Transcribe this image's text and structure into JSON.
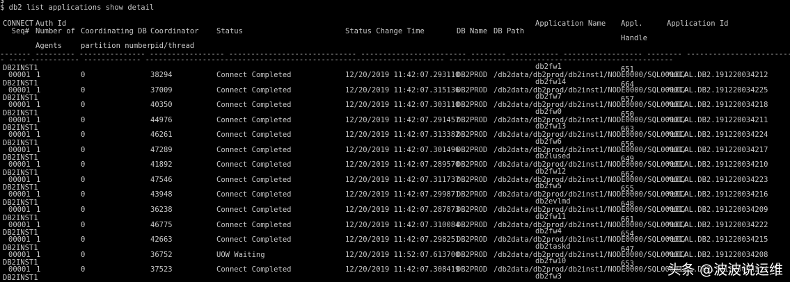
{
  "prompt_line": "$ db2 list applications show detail",
  "headers": {
    "connect_seq_1": "CONNECT",
    "connect_seq_2": "  Seq#",
    "auth_id": "Auth Id",
    "num_agents_1": "Number of",
    "num_agents_2": "Agents",
    "coord_db_part_1": "Coordinating DB",
    "coord_db_part_2": "partition number",
    "coord_pid_1": "Coordinator",
    "coord_pid_2": "pid/thread",
    "status": "Status",
    "status_change_time": "Status Change Time",
    "db_name": "DB Name",
    "db_path": "DB Path",
    "app_name": "Application Name",
    "appl_handle_1": "Appl.",
    "appl_handle_2": "Handle",
    "app_id": "Application Id"
  },
  "rows": [
    {
      "auth": "DB2INST1",
      "seq": "00001",
      "agents": "1",
      "part": "0",
      "pid": "38294",
      "status": "Connect Completed",
      "time": "12/20/2019 11:42:07.293110",
      "db": "DB2PROD",
      "path": "/db2data/db2prod/db2inst1/NODE0000/SQL00001/",
      "app": "db2fw1",
      "handle": "651",
      "appid": "*LOCAL.DB2.191220034212"
    },
    {
      "auth": "DB2INST1",
      "seq": "00001",
      "agents": "1",
      "part": "0",
      "pid": "37009",
      "status": "Connect Completed",
      "time": "12/20/2019 11:42:07.315136",
      "db": "DB2PROD",
      "path": "/db2data/db2prod/db2inst1/NODE0000/SQL00001/",
      "app": "db2fw14",
      "handle": "664",
      "appid": "*LOCAL.DB2.191220034225"
    },
    {
      "auth": "DB2INST1",
      "seq": "00001",
      "agents": "1",
      "part": "0",
      "pid": "40350",
      "status": "Connect Completed",
      "time": "12/20/2019 11:42:07.303110",
      "db": "DB2PROD",
      "path": "/db2data/db2prod/db2inst1/NODE0000/SQL00001/",
      "app": "db2fw7",
      "handle": "657",
      "appid": "*LOCAL.DB2.191220034218"
    },
    {
      "auth": "DB2INST1",
      "seq": "00001",
      "agents": "1",
      "part": "0",
      "pid": "44976",
      "status": "Connect Completed",
      "time": "12/20/2019 11:42:07.291457",
      "db": "DB2PROD",
      "path": "/db2data/db2prod/db2inst1/NODE0000/SQL00001/",
      "app": "db2fw0",
      "handle": "650",
      "appid": "*LOCAL.DB2.191220034211"
    },
    {
      "auth": "DB2INST1",
      "seq": "00001",
      "agents": "1",
      "part": "0",
      "pid": "46261",
      "status": "Connect Completed",
      "time": "12/20/2019 11:42:07.313382",
      "db": "DB2PROD",
      "path": "/db2data/db2prod/db2inst1/NODE0000/SQL00001/",
      "app": "db2fw13",
      "handle": "663",
      "appid": "*LOCAL.DB2.191220034224"
    },
    {
      "auth": "DB2INST1",
      "seq": "00001",
      "agents": "1",
      "part": "0",
      "pid": "47289",
      "status": "Connect Completed",
      "time": "12/20/2019 11:42:07.301496",
      "db": "DB2PROD",
      "path": "/db2data/db2prod/db2inst1/NODE0000/SQL00001/",
      "app": "db2fw6",
      "handle": "656",
      "appid": "*LOCAL.DB2.191220034217"
    },
    {
      "auth": "DB2INST1",
      "seq": "00001",
      "agents": "1",
      "part": "0",
      "pid": "41892",
      "status": "Connect Completed",
      "time": "12/20/2019 11:42:07.289570",
      "db": "DB2PROD",
      "path": "/db2data/db2prod/db2inst1/NODE0000/SQL00001/",
      "app": "db2lused",
      "handle": "649",
      "appid": "*LOCAL.DB2.191220034210"
    },
    {
      "auth": "DB2INST1",
      "seq": "00001",
      "agents": "1",
      "part": "0",
      "pid": "47546",
      "status": "Connect Completed",
      "time": "12/20/2019 11:42:07.311737",
      "db": "DB2PROD",
      "path": "/db2data/db2prod/db2inst1/NODE0000/SQL00001/",
      "app": "db2fw12",
      "handle": "662",
      "appid": "*LOCAL.DB2.191220034223"
    },
    {
      "auth": "DB2INST1",
      "seq": "00001",
      "agents": "1",
      "part": "0",
      "pid": "43948",
      "status": "Connect Completed",
      "time": "12/20/2019 11:42:07.299871",
      "db": "DB2PROD",
      "path": "/db2data/db2prod/db2inst1/NODE0000/SQL00001/",
      "app": "db2fw5",
      "handle": "655",
      "appid": "*LOCAL.DB2.191220034216"
    },
    {
      "auth": "DB2INST1",
      "seq": "00001",
      "agents": "1",
      "part": "0",
      "pid": "36238",
      "status": "Connect Completed",
      "time": "12/20/2019 11:42:07.287873",
      "db": "DB2PROD",
      "path": "/db2data/db2prod/db2inst1/NODE0000/SQL00001/",
      "app": "db2evlmd",
      "handle": "648",
      "appid": "*LOCAL.DB2.191220034209"
    },
    {
      "auth": "DB2INST1",
      "seq": "00001",
      "agents": "1",
      "part": "0",
      "pid": "46775",
      "status": "Connect Completed",
      "time": "12/20/2019 11:42:07.310084",
      "db": "DB2PROD",
      "path": "/db2data/db2prod/db2inst1/NODE0000/SQL00001/",
      "app": "db2fw11",
      "handle": "661",
      "appid": "*LOCAL.DB2.191220034222"
    },
    {
      "auth": "DB2INST1",
      "seq": "00001",
      "agents": "1",
      "part": "0",
      "pid": "42663",
      "status": "Connect Completed",
      "time": "12/20/2019 11:42:07.298251",
      "db": "DB2PROD",
      "path": "/db2data/db2prod/db2inst1/NODE0000/SQL00001/",
      "app": "db2fw4",
      "handle": "654",
      "appid": "*LOCAL.DB2.191220034215"
    },
    {
      "auth": "DB2INST1",
      "seq": "00001",
      "agents": "1",
      "part": "0",
      "pid": "36752",
      "status": "UOW Waiting",
      "time": "12/20/2019 11:52:07.613700",
      "db": "DB2PROD",
      "path": "/db2data/db2prod/db2inst1/NODE0000/SQL00001/",
      "app": "db2taskd",
      "handle": "647",
      "appid": "*LOCAL.DB2.191220034208"
    },
    {
      "auth": "DB2INST1",
      "seq": "00001",
      "agents": "1",
      "part": "0",
      "pid": "37523",
      "status": "Connect Completed",
      "time": "12/20/2019 11:42:07.308419",
      "db": "DB2PROD",
      "path": "/db2data/db2prod/db2inst1/NODE0000/SQL00001/",
      "app": "db2fw10",
      "handle": "653",
      "appid": "*LOCAL.DB2.191220034214"
    }
  ],
  "tail": {
    "auth": "DB2INST1",
    "app": "db2fw3"
  },
  "watermark": "头条 @波波说运维"
}
